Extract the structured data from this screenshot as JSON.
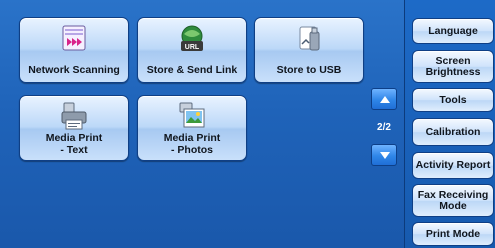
{
  "tiles": [
    {
      "label": "Network Scanning",
      "icon": "network-scanning-icon"
    },
    {
      "label": "Store & Send Link",
      "icon": "store-send-link-icon"
    },
    {
      "label": "Store to USB",
      "icon": "store-to-usb-icon"
    },
    {
      "label": "Media Print",
      "label2": "- Text",
      "icon": "media-print-text-icon"
    },
    {
      "label": "Media Print",
      "label2": "- Photos",
      "icon": "media-print-photos-icon"
    }
  ],
  "url_badge": "URL",
  "pager": {
    "indicator": "2/2"
  },
  "sidebar": {
    "items": [
      {
        "label": "Language"
      },
      {
        "label": "Screen",
        "label2": "Brightness"
      },
      {
        "label": "Tools"
      },
      {
        "label": "Calibration"
      },
      {
        "label": "Activity Report"
      },
      {
        "label": "Fax Receiving",
        "label2": "Mode"
      },
      {
        "label": "Print Mode"
      }
    ]
  },
  "colors": {
    "accent": "#1f63b9",
    "tile": "#bcd8f8"
  }
}
